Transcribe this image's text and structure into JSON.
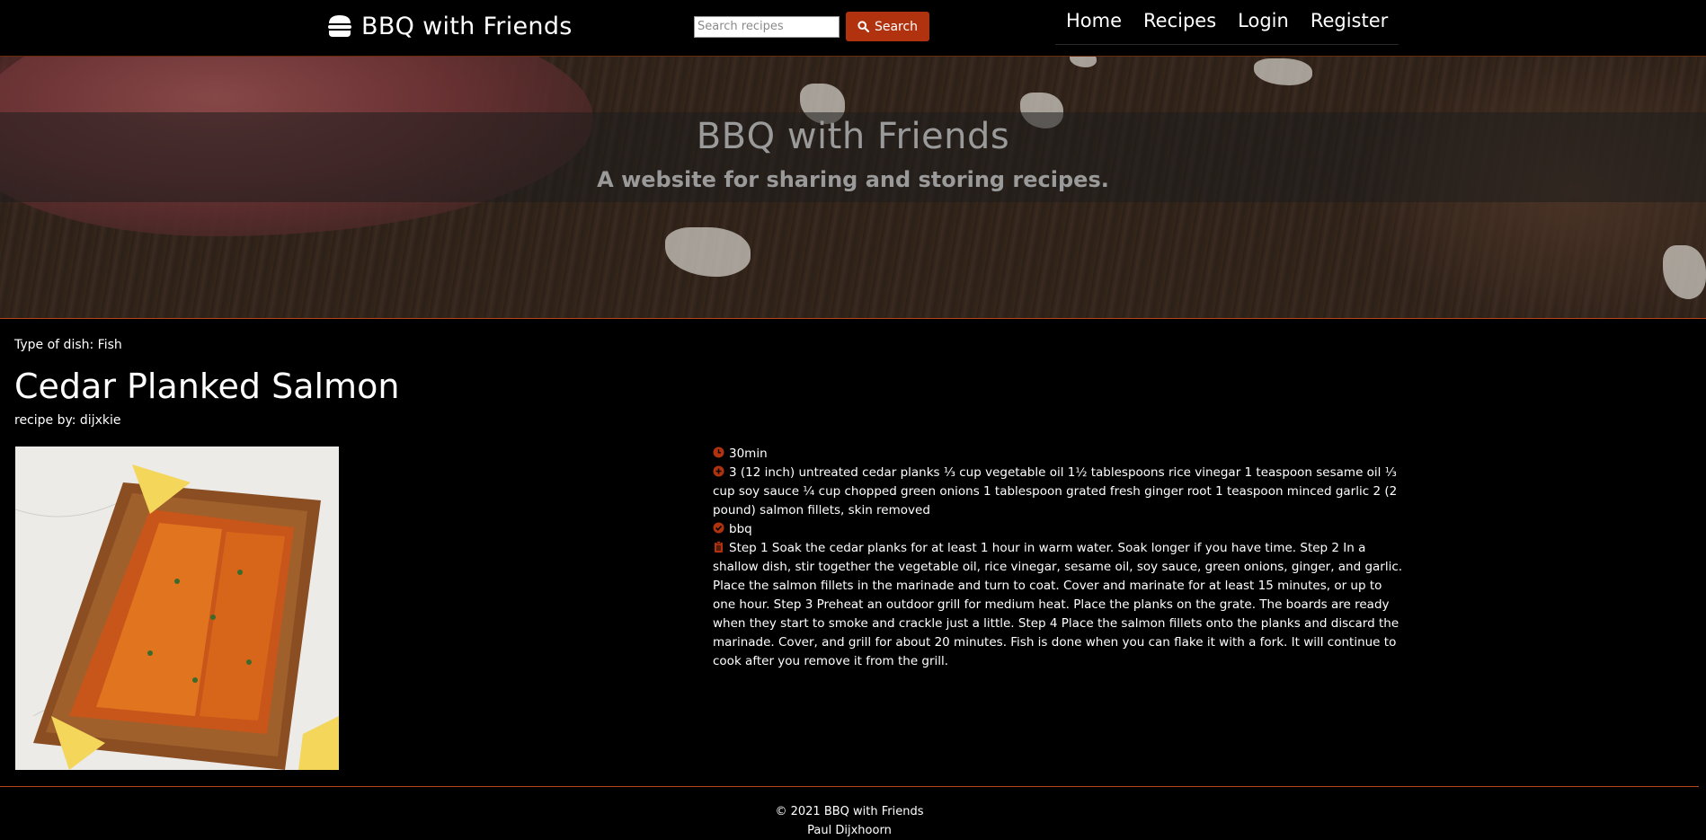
{
  "nav": {
    "brand": "BBQ with Friends",
    "brand_icon": "burger-icon",
    "search_placeholder": "Search recipes",
    "search_label": "Search",
    "links": [
      {
        "label": "Home"
      },
      {
        "label": "Recipes"
      },
      {
        "label": "Login"
      },
      {
        "label": "Register"
      }
    ]
  },
  "hero": {
    "title": "BBQ with Friends",
    "subtitle": "A website for sharing and storing recipes."
  },
  "recipe": {
    "dish_type": "Type of dish: Fish",
    "title": "Cedar Planked Salmon",
    "author": "recipe by: dijxkie",
    "time": "30min",
    "ingredients": "3 (12 inch) untreated cedar planks ⅓ cup vegetable oil 1½ tablespoons rice vinegar 1 teaspoon sesame oil ⅓ cup soy sauce ¼ cup chopped green onions 1 tablespoon grated fresh ginger root 1 teaspoon minced garlic 2 (2 pound) salmon fillets, skin removed",
    "tag": "bbq",
    "instructions": "Step 1 Soak the cedar planks for at least 1 hour in warm water. Soak longer if you have time. Step 2 In a shallow dish, stir together the vegetable oil, rice vinegar, sesame oil, soy sauce, green onions, ginger, and garlic. Place the salmon fillets in the marinade and turn to coat. Cover and marinate for at least 15 minutes, or up to one hour. Step 3 Preheat an outdoor grill for medium heat. Place the planks on the grate. The boards are ready when they start to smoke and crackle just a little. Step 4 Place the salmon fillets onto the planks and discard the marinade. Cover, and grill for about 20 minutes. Fish is done when you can flake it with a fork. It will continue to cook after you remove it from the grill."
  },
  "footer": {
    "copyright": "© 2021 BBQ with Friends",
    "author": "Paul Dijxhoorn"
  },
  "colors": {
    "accent": "#b0320f",
    "divider": "#b8451a",
    "background": "#000000"
  }
}
